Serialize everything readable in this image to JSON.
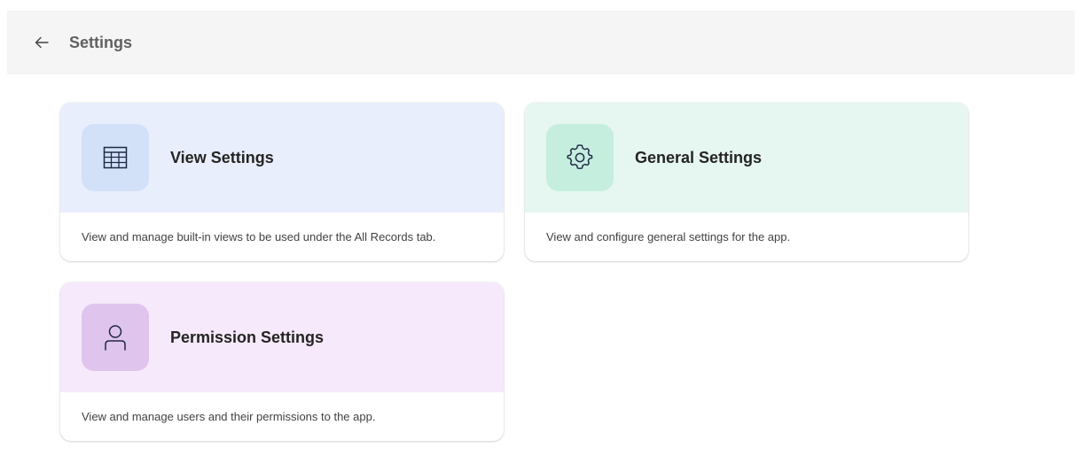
{
  "header": {
    "title": "Settings",
    "back_icon": "arrow-left-icon"
  },
  "cards": [
    {
      "title": "View Settings",
      "description": "View and manage built-in views to be used under the All Records tab.",
      "icon": "table-grid-icon",
      "colors": {
        "banner": "#e8eefc",
        "tile": "#d2e0f8"
      }
    },
    {
      "title": "General Settings",
      "description": "View and configure general settings for the app.",
      "icon": "gear-icon",
      "colors": {
        "banner": "#e6f6f0",
        "tile": "#c6eedf"
      }
    },
    {
      "title": "Permission Settings",
      "description": "View and manage users and their permissions to the app.",
      "icon": "person-icon",
      "colors": {
        "banner": "#f6e9fb",
        "tile": "#dfc4ee"
      }
    }
  ],
  "colors": {
    "header_bg": "#f5f5f5",
    "icon_stroke": "#1f2a44"
  }
}
